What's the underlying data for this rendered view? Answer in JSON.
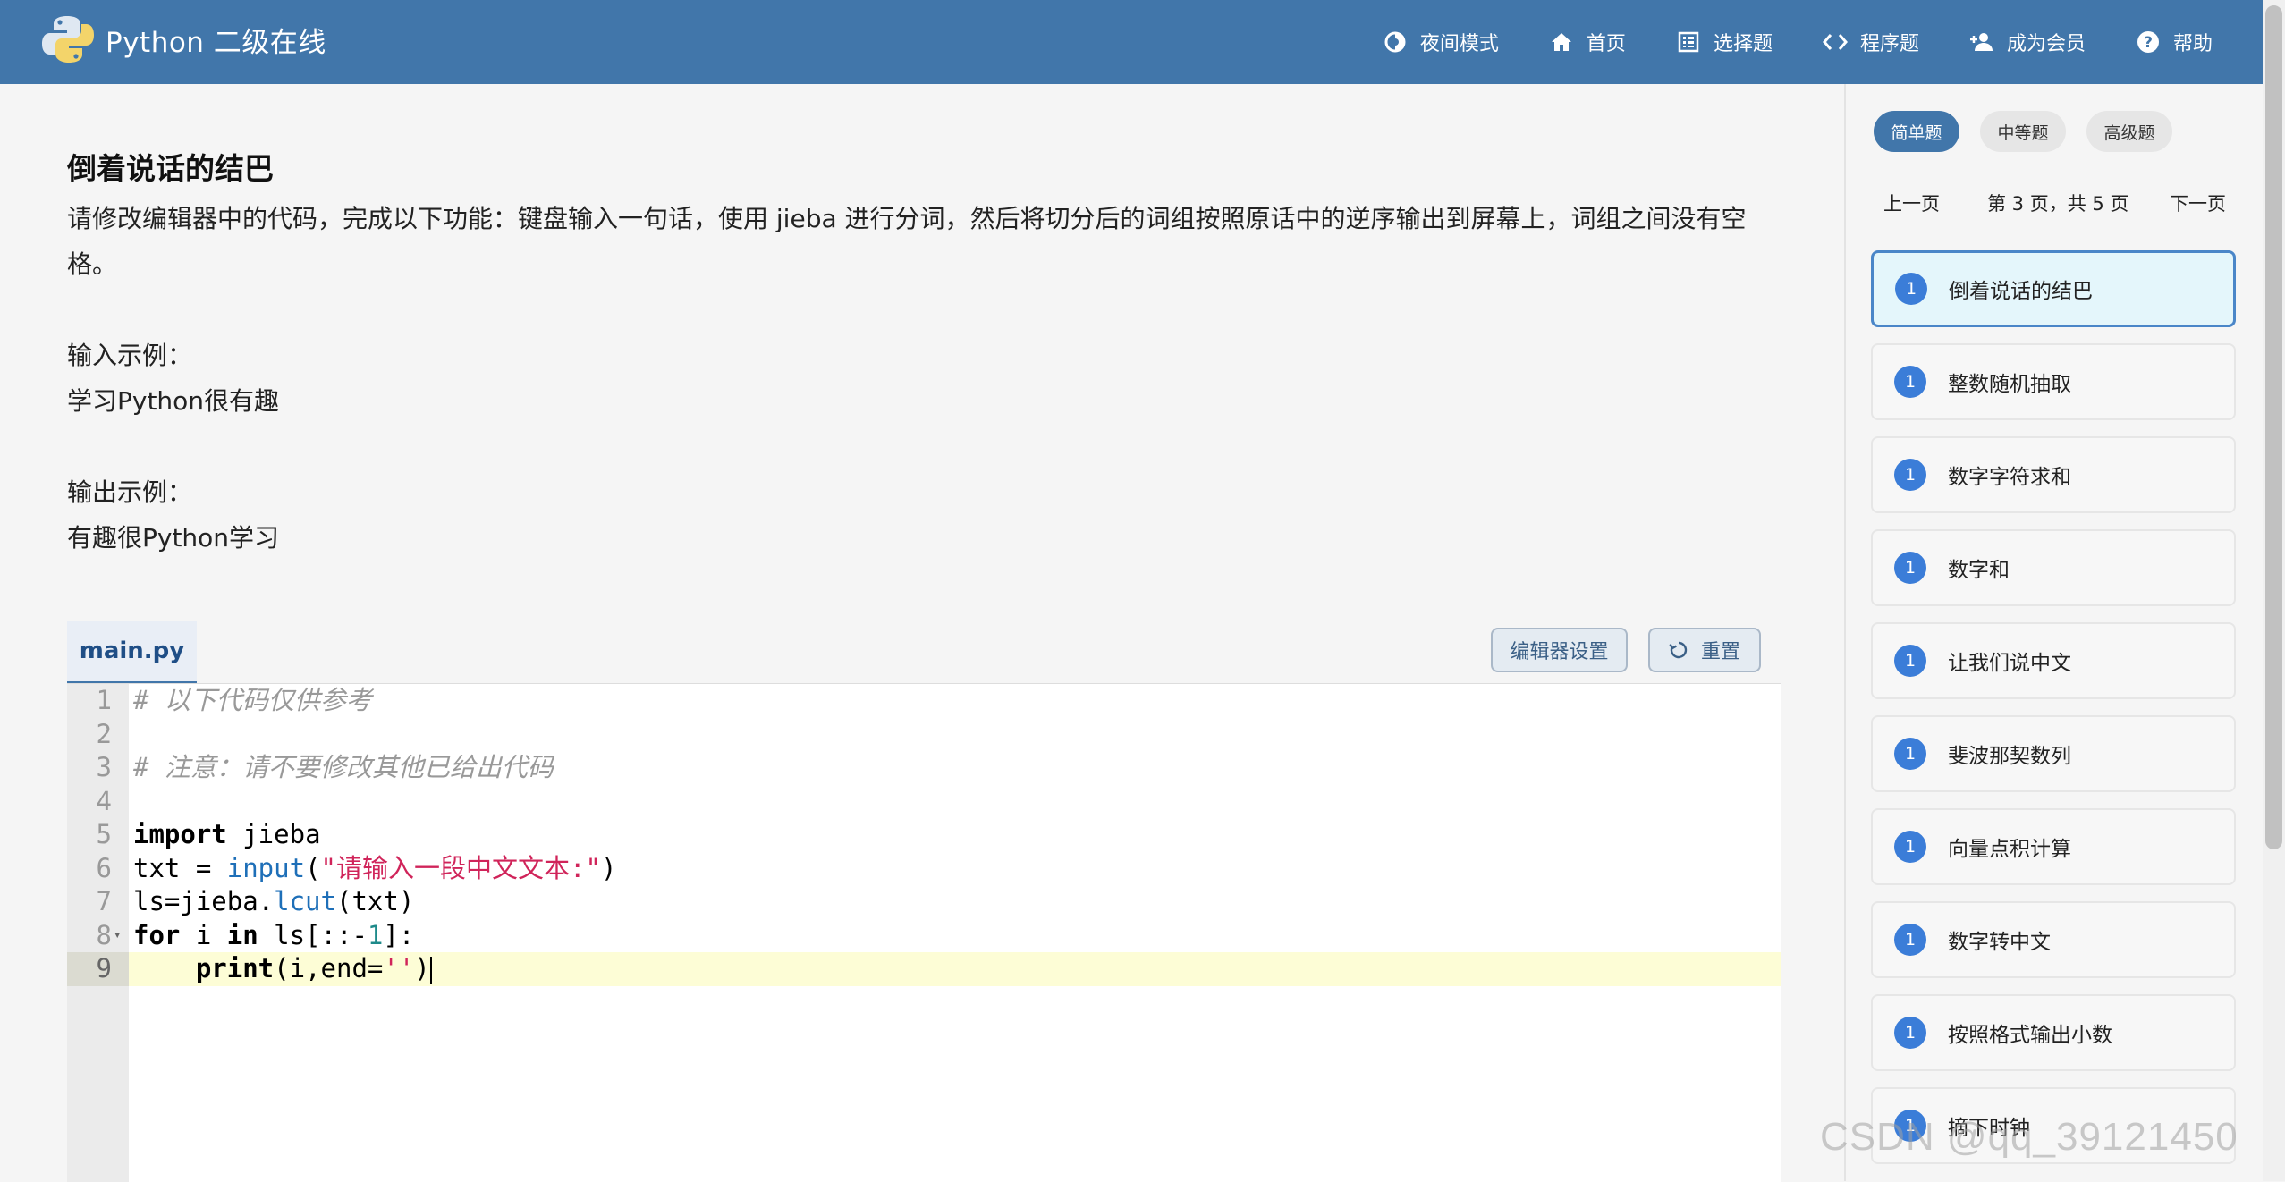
{
  "app": {
    "title": "Python 二级在线"
  },
  "nav": {
    "night_mode": "夜间模式",
    "home": "首页",
    "choice": "选择题",
    "programming": "程序题",
    "member": "成为会员",
    "help": "帮助"
  },
  "problem": {
    "title": "倒着说话的结巴",
    "desc": "请修改编辑器中的代码，完成以下功能：键盘输入一句话，使用 jieba 进行分词，然后将切分后的词组按照原话中的逆序输出到屏幕上，词组之间没有空格。",
    "input_label": "输入示例：",
    "input_value": "学习Python很有趣",
    "output_label": "输出示例：",
    "output_value": "有趣很Python学习"
  },
  "editor": {
    "filename": "main.py",
    "settings_label": "编辑器设置",
    "reset_label": "重置",
    "lines": [
      {
        "n": "1",
        "tokens": [
          {
            "t": "# 以下代码仅供参考",
            "c": "c-cm"
          }
        ]
      },
      {
        "n": "2",
        "tokens": []
      },
      {
        "n": "3",
        "tokens": [
          {
            "t": "# 注意：请不要修改其他已给出代码",
            "c": "c-cm"
          }
        ]
      },
      {
        "n": "4",
        "tokens": []
      },
      {
        "n": "5",
        "tokens": [
          {
            "t": "import",
            "c": "c-kw"
          },
          {
            "t": " jieba",
            "c": ""
          }
        ]
      },
      {
        "n": "6",
        "tokens": [
          {
            "t": "txt = ",
            "c": ""
          },
          {
            "t": "input",
            "c": "c-fn"
          },
          {
            "t": "(",
            "c": ""
          },
          {
            "t": "\"请输入一段中文文本:\"",
            "c": "c-st"
          },
          {
            "t": ")",
            "c": ""
          }
        ]
      },
      {
        "n": "7",
        "tokens": [
          {
            "t": "ls=jieba.",
            "c": ""
          },
          {
            "t": "lcut",
            "c": "c-fn"
          },
          {
            "t": "(txt)",
            "c": ""
          }
        ]
      },
      {
        "n": "8",
        "fold": true,
        "tokens": [
          {
            "t": "for",
            "c": "c-kw"
          },
          {
            "t": " i ",
            "c": ""
          },
          {
            "t": "in",
            "c": "c-kw"
          },
          {
            "t": " ls[::-",
            "c": ""
          },
          {
            "t": "1",
            "c": "c-nm"
          },
          {
            "t": "]:",
            "c": ""
          }
        ]
      },
      {
        "n": "9",
        "active": true,
        "tokens": [
          {
            "t": "    ",
            "c": ""
          },
          {
            "t": "print",
            "c": "c-kw"
          },
          {
            "t": "(i,end=",
            "c": ""
          },
          {
            "t": "''",
            "c": "c-st"
          },
          {
            "t": ")",
            "c": ""
          }
        ]
      }
    ]
  },
  "sidebar": {
    "levels": [
      "简单题",
      "中等题",
      "高级题"
    ],
    "active_level": 0,
    "prev": "上一页",
    "page_info": "第 3 页，共 5 页",
    "next": "下一页",
    "questions": [
      {
        "num": "1",
        "title": "倒着说话的结巴",
        "active": true
      },
      {
        "num": "1",
        "title": "整数随机抽取"
      },
      {
        "num": "1",
        "title": "数字字符求和"
      },
      {
        "num": "1",
        "title": "数字和"
      },
      {
        "num": "1",
        "title": "让我们说中文"
      },
      {
        "num": "1",
        "title": "斐波那契数列"
      },
      {
        "num": "1",
        "title": "向量点积计算"
      },
      {
        "num": "1",
        "title": "数字转中文"
      },
      {
        "num": "1",
        "title": "按照格式输出小数"
      },
      {
        "num": "1",
        "title": "摘下时钟"
      }
    ]
  },
  "watermark": "CSDN @qq_39121450"
}
